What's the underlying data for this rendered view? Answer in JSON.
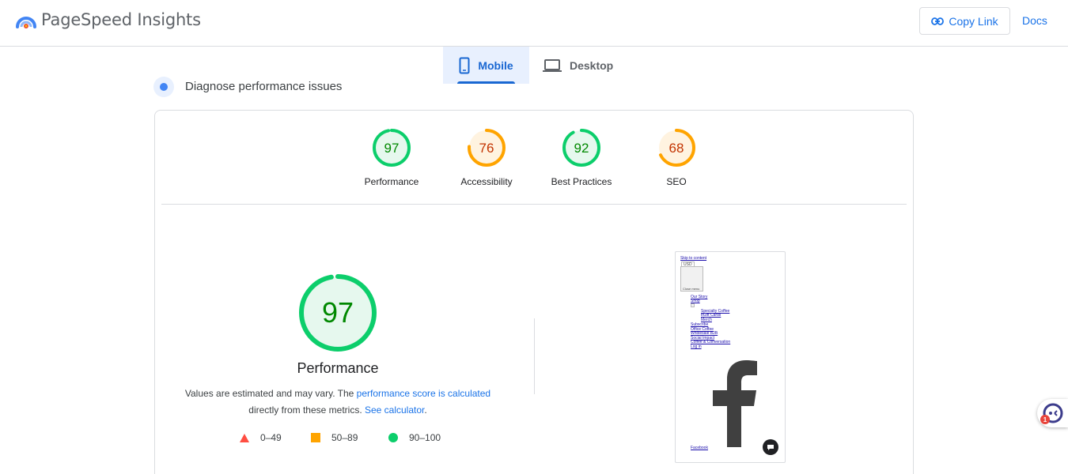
{
  "header": {
    "brand": "PageSpeed Insights",
    "copy_link": "Copy Link",
    "docs": "Docs"
  },
  "tabs": {
    "mobile": "Mobile",
    "desktop": "Desktop",
    "selected": "Mobile"
  },
  "section": {
    "title": "Diagnose performance issues"
  },
  "scores": [
    {
      "label": "Performance",
      "score": "97",
      "level": "pass"
    },
    {
      "label": "Accessibility",
      "score": "76",
      "level": "average"
    },
    {
      "label": "Best Practices",
      "score": "92",
      "level": "pass"
    },
    {
      "label": "SEO",
      "score": "68",
      "level": "average"
    }
  ],
  "performance": {
    "score": "97",
    "title": "Performance",
    "desc_prefix": "Values are estimated and may vary. The ",
    "desc_link": "performance score is calculated",
    "desc_middle": " directly from these metrics. ",
    "desc_link2": "See calculator",
    "desc_suffix": "."
  },
  "legend": {
    "fail": "0–49",
    "average": "50–89",
    "pass": "90–100"
  },
  "screenshot": {
    "skip": "Skip to content",
    "currency": "USD",
    "close": "Close menu",
    "nav": [
      "Our Story",
      "Shop",
      "Specialty Coffee",
      "eGift Cards",
      "Merch",
      "Subscribe",
      "Office Coffee",
      "Wholesale B2B",
      "Social Impact",
      "Coffee & Conversation",
      "Log in"
    ],
    "footer_link": "Facebook"
  },
  "assistant": {
    "badge": "1"
  },
  "colors": {
    "pass": "#0cce6b",
    "pass_text": "#008800",
    "pass_bg": "#e6f8ee",
    "average": "#ffa400",
    "average_text": "#c33300",
    "average_bg": "#fff3e0",
    "fail": "#ff4e42",
    "accent": "#1a73e8"
  }
}
